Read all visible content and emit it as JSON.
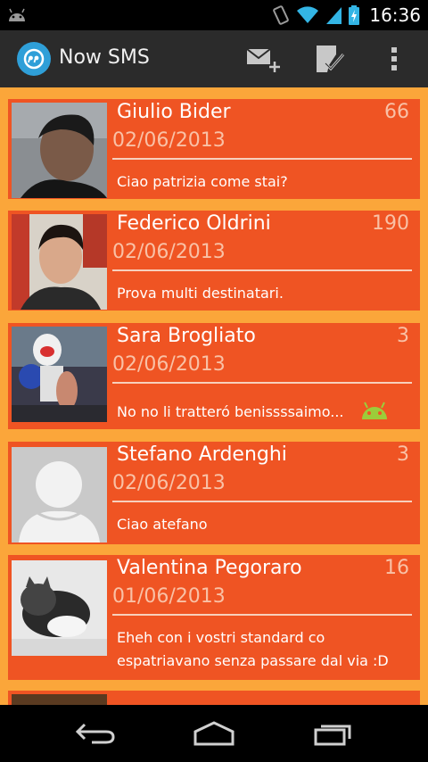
{
  "status_bar": {
    "time": "16:36"
  },
  "app": {
    "title": "Now SMS"
  },
  "conversations": [
    {
      "name": "Giulio Bider",
      "count": "66",
      "date": "02/06/2013",
      "message": "Ciao patrizia come stai?"
    },
    {
      "name": "Federico Oldrini",
      "count": "190",
      "date": "02/06/2013",
      "message": "Prova multi destinatari."
    },
    {
      "name": "Sara Brogliato",
      "count": "3",
      "date": "02/06/2013",
      "message": "No no li tratteró benissssaimo..."
    },
    {
      "name": "Stefano Ardenghi",
      "count": "3",
      "date": "02/06/2013",
      "message": "Ciao atefano"
    },
    {
      "name": "Valentina Pegoraro",
      "count": "16",
      "date": "01/06/2013",
      "message": "Eheh con i vostri standard co espatriavano senza passare dal via :D"
    }
  ],
  "colors": {
    "card": "#ef5423",
    "list_background": "#fba63a",
    "action_bar": "#2b2b2b"
  }
}
